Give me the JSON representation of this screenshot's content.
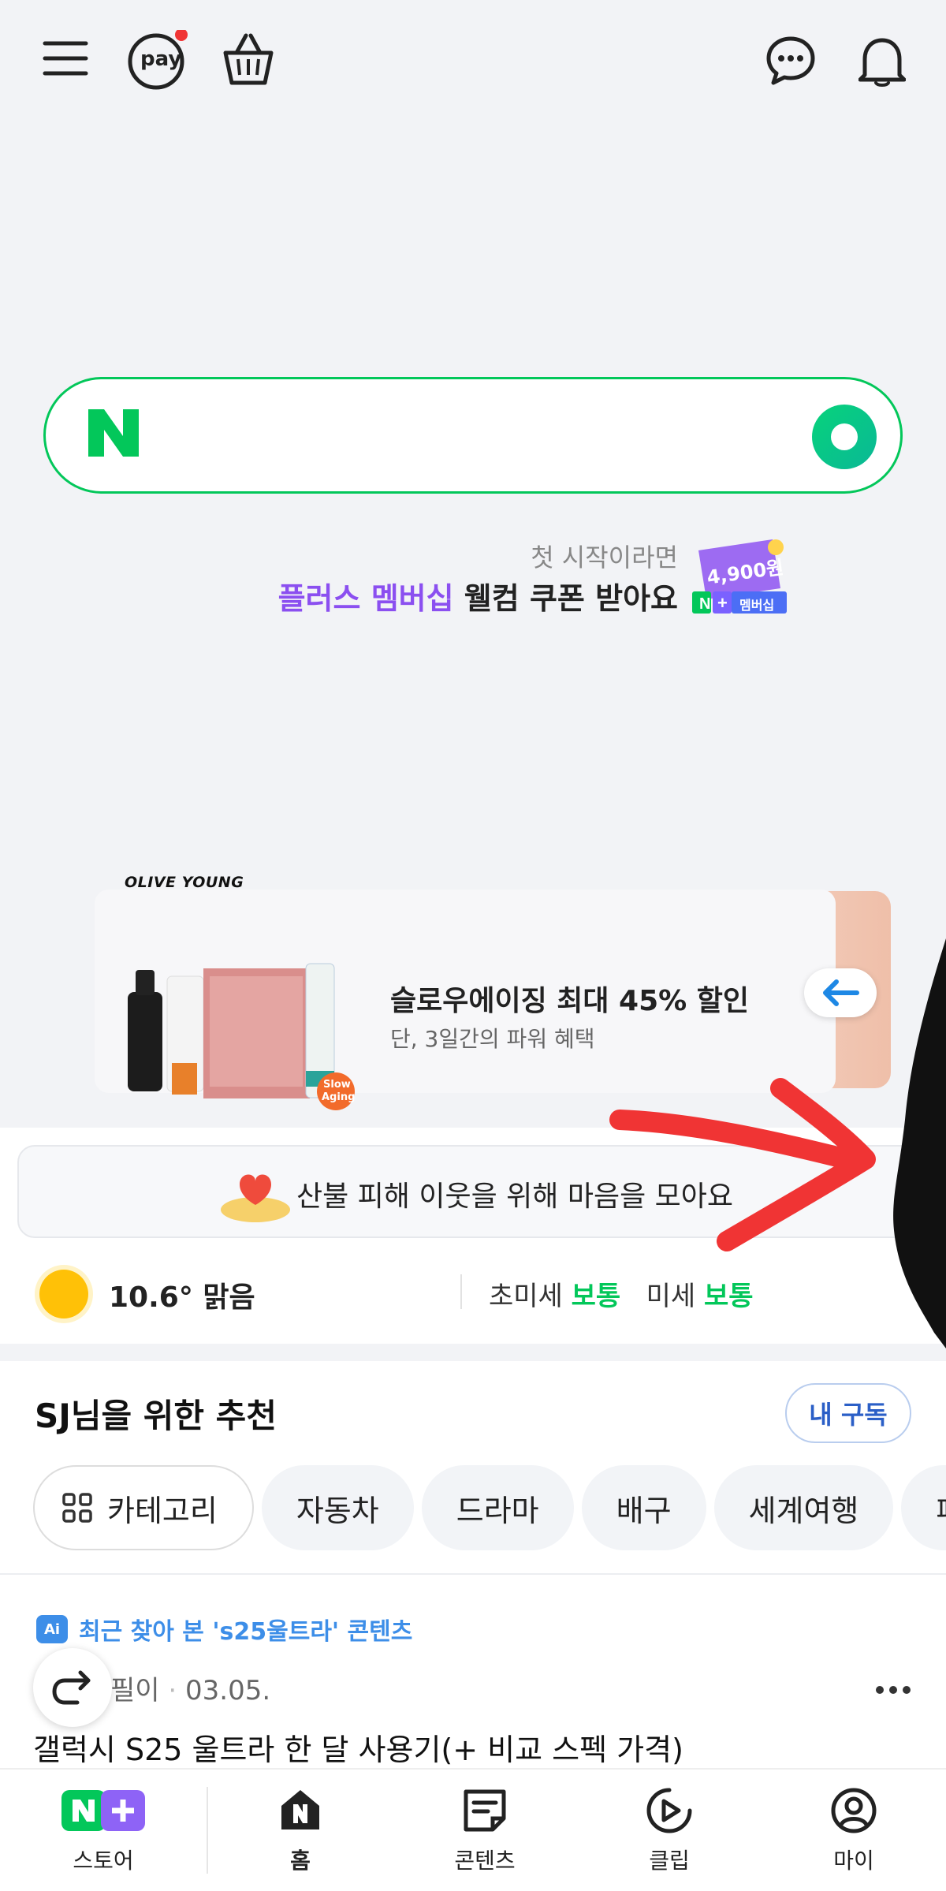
{
  "header": {
    "pay_label": "pay"
  },
  "search": {
    "placeholder": ""
  },
  "promo": {
    "subtitle": "첫 시작이라면",
    "title_accent": "플러스 멤버십",
    "title_rest": " 웰컴 쿠폰 받아요",
    "coupon_amount": "4,900원",
    "coupon_badge": "멤버십"
  },
  "banner": {
    "brand": "OLIVE YOUNG",
    "title": "슬로우에이징 최대 45% 할인",
    "subtitle": "단, 3일간의 파워 혜택",
    "product_sticker_1": "Slow",
    "product_sticker_2": "Aging"
  },
  "donation": {
    "text": "산불 피해 이웃을 위해 마음을 모아요"
  },
  "weather": {
    "temperature": "10.6°",
    "condition": "맑음",
    "fine_dust_label": "초미세",
    "fine_dust_value": "보통",
    "dust_label": "미세",
    "dust_value": "보통"
  },
  "recommend": {
    "title": "SJ님을 위한 추천",
    "subscribe_label": "내 구독",
    "chips": [
      "카테고리",
      "자동차",
      "드라마",
      "배구",
      "세계여행",
      "패"
    ]
  },
  "feed": {
    "ai_badge": "Ai",
    "recent_label": "최근 찾아 본 's25울트라' 콘텐츠",
    "author": "필이",
    "date": "03.05.",
    "post_title": "갤럭시 S25 울트라 한 달 사용기(+ 비교 스펙 가격)"
  },
  "bottom_nav": {
    "store": "스토어",
    "home": "홈",
    "contents": "콘텐츠",
    "clip": "클립",
    "my": "마이"
  },
  "colors": {
    "naver_green": "#03c75a",
    "accent_purple": "#8b4ff0",
    "link_blue": "#3d8ee8",
    "annotation_red": "#f03434"
  }
}
